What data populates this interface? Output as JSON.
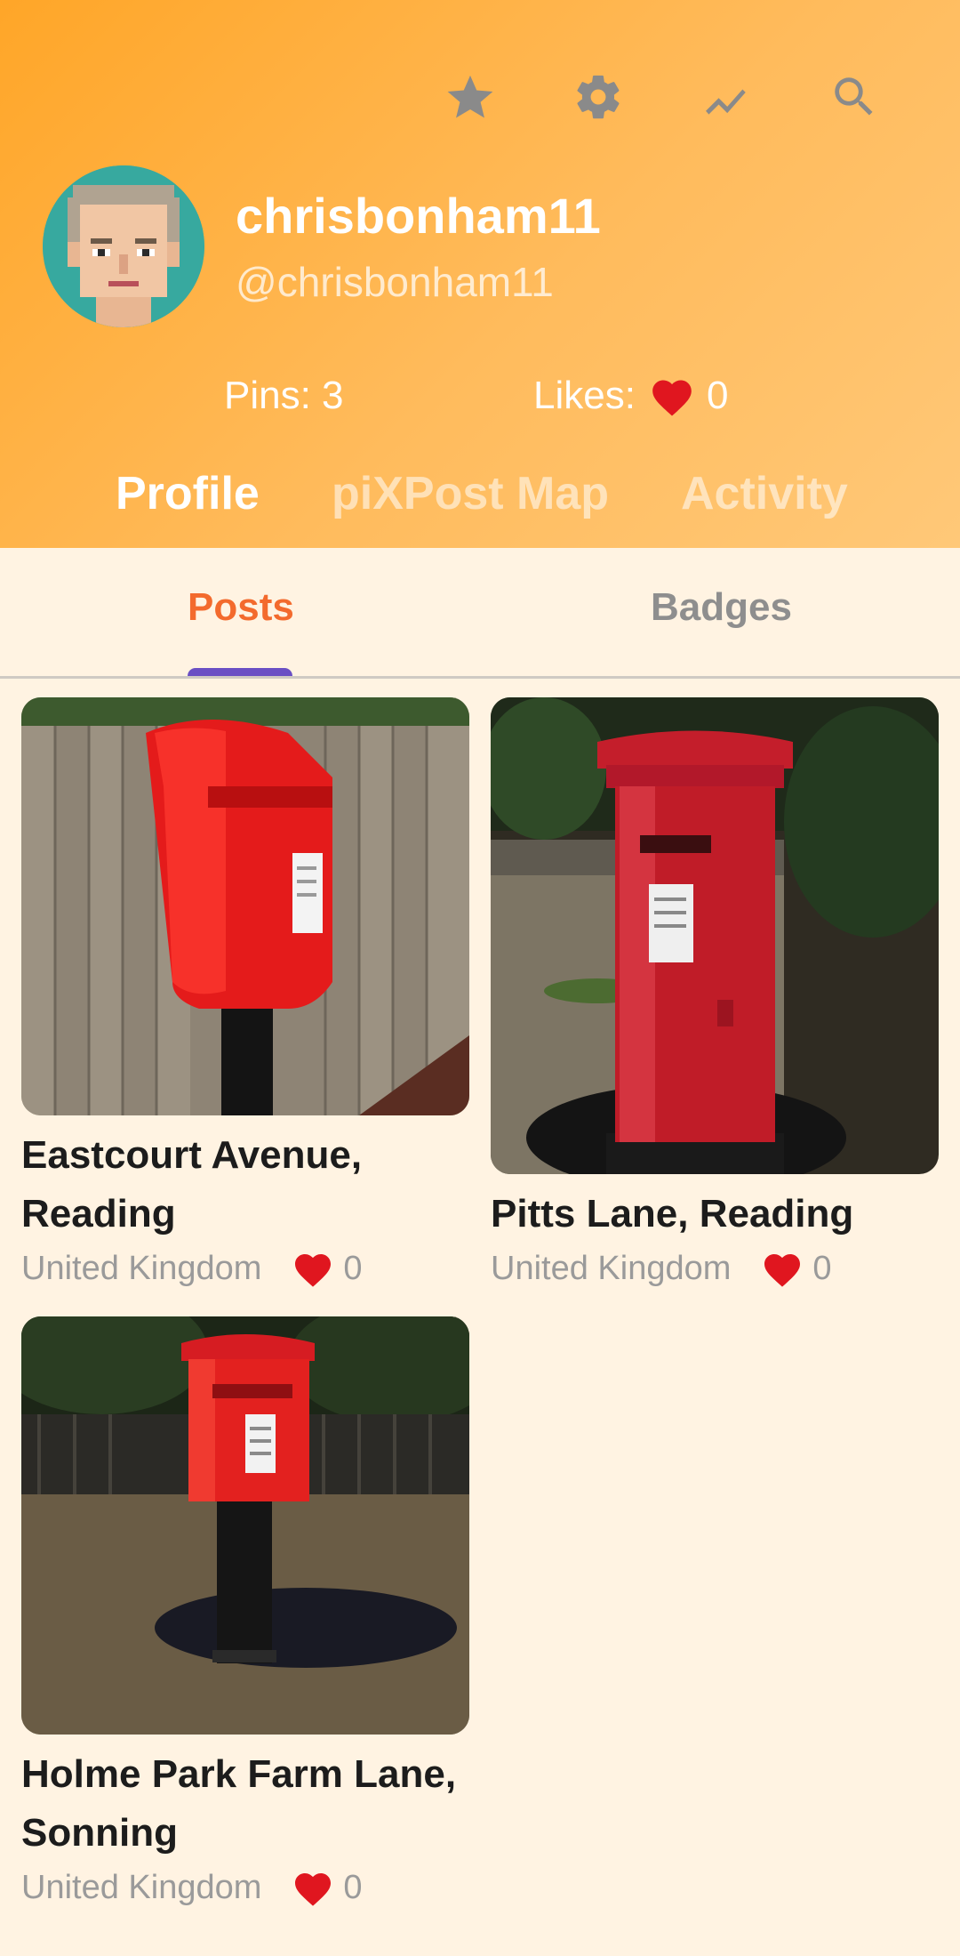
{
  "header": {
    "icons": [
      "star-icon",
      "gear-icon",
      "trending-icon",
      "search-icon"
    ],
    "username": "chrisbonham11",
    "handle": "@chrisbonham11",
    "pins_label": "Pins: 3",
    "likes_label": "Likes:",
    "likes_count": "0",
    "nav_tabs": [
      "Profile",
      "piXPost Map",
      "Activity"
    ],
    "active_nav_tab": "Profile"
  },
  "subtabs": {
    "items": [
      "Posts",
      "Badges"
    ],
    "active": "Posts"
  },
  "posts": [
    {
      "title": "Eastcourt Avenue, Reading",
      "country": "United Kingdom",
      "likes": "0"
    },
    {
      "title": "Pitts Lane, Reading",
      "country": "United Kingdom",
      "likes": "0"
    },
    {
      "title": "Holme Park Farm Lane, Sonning",
      "country": "United Kingdom",
      "likes": "0"
    }
  ],
  "colors": {
    "header_gradient_start": "#ffa628",
    "header_gradient_end": "#ffc878",
    "background": "#fff3e2",
    "active_subtab": "#f36a2d",
    "indicator": "#6a4fc4",
    "heart": "#e0161f"
  }
}
